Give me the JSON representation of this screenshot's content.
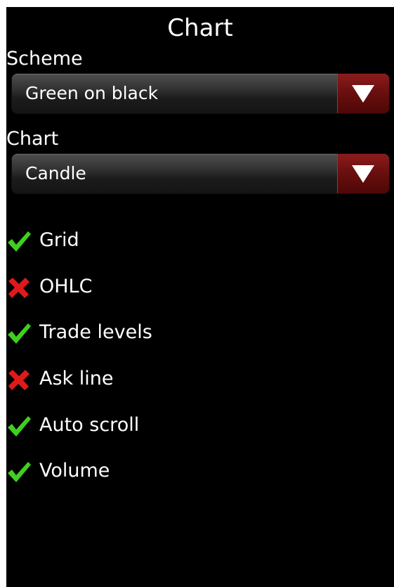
{
  "title": "Chart",
  "scheme": {
    "label": "Scheme",
    "selected": "Green on black"
  },
  "chart": {
    "label": "Chart",
    "selected": "Candle"
  },
  "options": [
    {
      "label": "Grid",
      "checked": true,
      "icon": "check-icon"
    },
    {
      "label": "OHLC",
      "checked": false,
      "icon": "cross-icon"
    },
    {
      "label": "Trade levels",
      "checked": true,
      "icon": "check-icon"
    },
    {
      "label": "Ask line",
      "checked": false,
      "icon": "cross-icon"
    },
    {
      "label": "Auto scroll",
      "checked": true,
      "icon": "check-icon"
    },
    {
      "label": "Volume",
      "checked": true,
      "icon": "check-icon"
    }
  ],
  "colors": {
    "background": "#000000",
    "text": "#ffffff",
    "dropdown_arrow": "#7a1414",
    "check": "#3fcf1e",
    "cross": "#e01a1a"
  }
}
